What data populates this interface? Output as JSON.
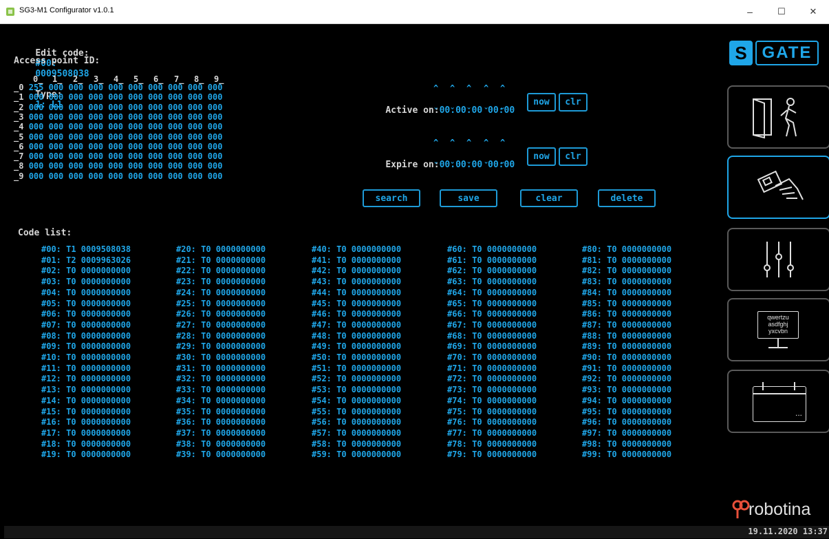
{
  "window": {
    "title": "SG3-M1 Configurator v1.0.1",
    "min": "–",
    "max": "☐",
    "close": "✕"
  },
  "edit": {
    "label": "Edit code:",
    "code_id": "#00:",
    "code_value": "0009508038",
    "type_label": "Type:",
    "type_value": "1: L1"
  },
  "access": {
    "label": "Access point ID:",
    "col_headers": [
      "0_",
      "1_",
      "2_",
      "3_",
      "4_",
      "5_",
      "6_",
      "7_",
      "8_",
      "9_"
    ],
    "rows": [
      {
        "idx": "_0",
        "cells": "255 000 000 000 000 000 000 000 000 000"
      },
      {
        "idx": "_1",
        "cells": "000 000 000 000 000 000 000 000 000 000"
      },
      {
        "idx": "_2",
        "cells": "000 000 000 000 000 000 000 000 000 000"
      },
      {
        "idx": "_3",
        "cells": "000 000 000 000 000 000 000 000 000 000"
      },
      {
        "idx": "_4",
        "cells": "000 000 000 000 000 000 000 000 000 000"
      },
      {
        "idx": "_5",
        "cells": "000 000 000 000 000 000 000 000 000 000"
      },
      {
        "idx": "_6",
        "cells": "000 000 000 000 000 000 000 000 000 000"
      },
      {
        "idx": "_7",
        "cells": "000 000 000 000 000 000 000 000 000 000"
      },
      {
        "idx": "_8",
        "cells": "000 000 000 000 000 000 000 000 000 000"
      },
      {
        "idx": "_9",
        "cells": "000 000 000 000 000 000 000 000 000 000"
      }
    ]
  },
  "active": {
    "label": "Active on:",
    "value": "00.00.00 00:00",
    "now": "now",
    "clr": "clr"
  },
  "expire": {
    "label": "Expire on:",
    "value": "00.00.00 00:00",
    "now": "now",
    "clr": "clr"
  },
  "actions": {
    "search": "search",
    "save": "save",
    "clear": "clear",
    "delete": "delete"
  },
  "code_list": {
    "label": "Code list:",
    "columns": [
      "#00: T1 0009508038\n#01: T2 0009963026\n#02: T0 0000000000\n#03: T0 0000000000\n#04: T0 0000000000\n#05: T0 0000000000\n#06: T0 0000000000\n#07: T0 0000000000\n#08: T0 0000000000\n#09: T0 0000000000\n#10: T0 0000000000\n#11: T0 0000000000\n#12: T0 0000000000\n#13: T0 0000000000\n#14: T0 0000000000\n#15: T0 0000000000\n#16: T0 0000000000\n#17: T0 0000000000\n#18: T0 0000000000\n#19: T0 0000000000",
      "#20: T0 0000000000\n#21: T0 0000000000\n#22: T0 0000000000\n#23: T0 0000000000\n#24: T0 0000000000\n#25: T0 0000000000\n#26: T0 0000000000\n#27: T0 0000000000\n#28: T0 0000000000\n#29: T0 0000000000\n#30: T0 0000000000\n#31: T0 0000000000\n#32: T0 0000000000\n#33: T0 0000000000\n#34: T0 0000000000\n#35: T0 0000000000\n#36: T0 0000000000\n#37: T0 0000000000\n#38: T0 0000000000\n#39: T0 0000000000",
      "#40: T0 0000000000\n#41: T0 0000000000\n#42: T0 0000000000\n#43: T0 0000000000\n#44: T0 0000000000\n#45: T0 0000000000\n#46: T0 0000000000\n#47: T0 0000000000\n#48: T0 0000000000\n#49: T0 0000000000\n#50: T0 0000000000\n#51: T0 0000000000\n#52: T0 0000000000\n#53: T0 0000000000\n#54: T0 0000000000\n#55: T0 0000000000\n#56: T0 0000000000\n#57: T0 0000000000\n#58: T0 0000000000\n#59: T0 0000000000",
      "#60: T0 0000000000\n#61: T0 0000000000\n#62: T0 0000000000\n#63: T0 0000000000\n#64: T0 0000000000\n#65: T0 0000000000\n#66: T0 0000000000\n#67: T0 0000000000\n#68: T0 0000000000\n#69: T0 0000000000\n#70: T0 0000000000\n#71: T0 0000000000\n#72: T0 0000000000\n#73: T0 0000000000\n#74: T0 0000000000\n#75: T0 0000000000\n#76: T0 0000000000\n#77: T0 0000000000\n#78: T0 0000000000\n#79: T0 0000000000",
      "#80: T0 0000000000\n#81: T0 0000000000\n#82: T0 0000000000\n#83: T0 0000000000\n#84: T0 0000000000\n#85: T0 0000000000\n#86: T0 0000000000\n#87: T0 0000000000\n#88: T0 0000000000\n#89: T0 0000000000\n#90: T0 0000000000\n#91: T0 0000000000\n#92: T0 0000000000\n#93: T0 0000000000\n#94: T0 0000000000\n#95: T0 0000000000\n#96: T0 0000000000\n#97: T0 0000000000\n#98: T0 0000000000\n#99: T0 0000000000"
    ]
  },
  "sidebar": {
    "logo_s": "S",
    "logo_gate": "GATE",
    "keyboard_lines": [
      "qwertzu",
      "asdfghj",
      "yxcvbn"
    ],
    "calendar_dots": "..."
  },
  "brand": "robotina",
  "datetime": "19.11.2020 13:37",
  "colors": {
    "accent": "#1fa6e8",
    "background": "#000000",
    "text": "#d7d7d7"
  }
}
